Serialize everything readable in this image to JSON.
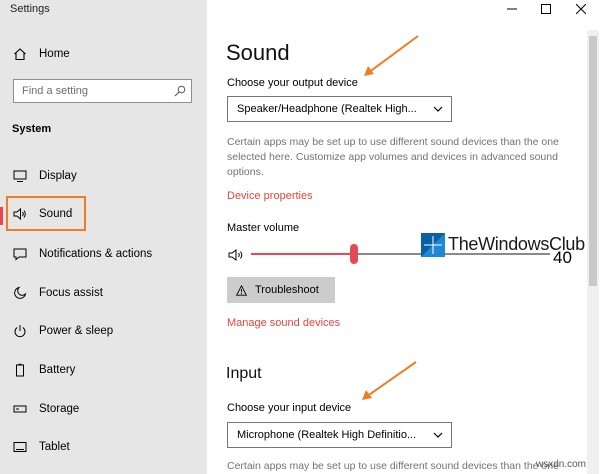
{
  "window": {
    "title": "Settings"
  },
  "sidebar": {
    "home_label": "Home",
    "search_placeholder": "Find a setting",
    "section_label": "System",
    "items": [
      {
        "label": "Display",
        "icon": "display-icon"
      },
      {
        "label": "Sound",
        "icon": "speaker-icon"
      },
      {
        "label": "Notifications & actions",
        "icon": "notifications-icon"
      },
      {
        "label": "Focus assist",
        "icon": "moon-icon"
      },
      {
        "label": "Power & sleep",
        "icon": "power-icon"
      },
      {
        "label": "Battery",
        "icon": "battery-icon"
      },
      {
        "label": "Storage",
        "icon": "storage-icon"
      },
      {
        "label": "Tablet",
        "icon": "tablet-icon"
      }
    ],
    "selected": "Sound"
  },
  "main": {
    "title": "Sound",
    "output": {
      "label": "Choose your output device",
      "selected_device": "Speaker/Headphone (Realtek High...",
      "description": "Certain apps may be set up to use different sound devices than the one selected here. Customize app volumes and devices in advanced sound options.",
      "device_properties_link": "Device properties",
      "master_volume_label": "Master volume",
      "volume_value": "40",
      "troubleshoot_label": "Troubleshoot",
      "manage_link": "Manage sound devices"
    },
    "input": {
      "title": "Input",
      "label": "Choose your input device",
      "selected_device": "Microphone (Realtek High Definitio...",
      "description": "Certain apps may be set up to use different sound devices than the one"
    }
  },
  "watermark": {
    "text": "TheWindowsClub",
    "site": "wsxdn.com"
  },
  "colors": {
    "accent": "#e74856",
    "highlight": "#f07d21",
    "link": "#e3463d",
    "sidebar_bg": "#e6e6e6"
  }
}
